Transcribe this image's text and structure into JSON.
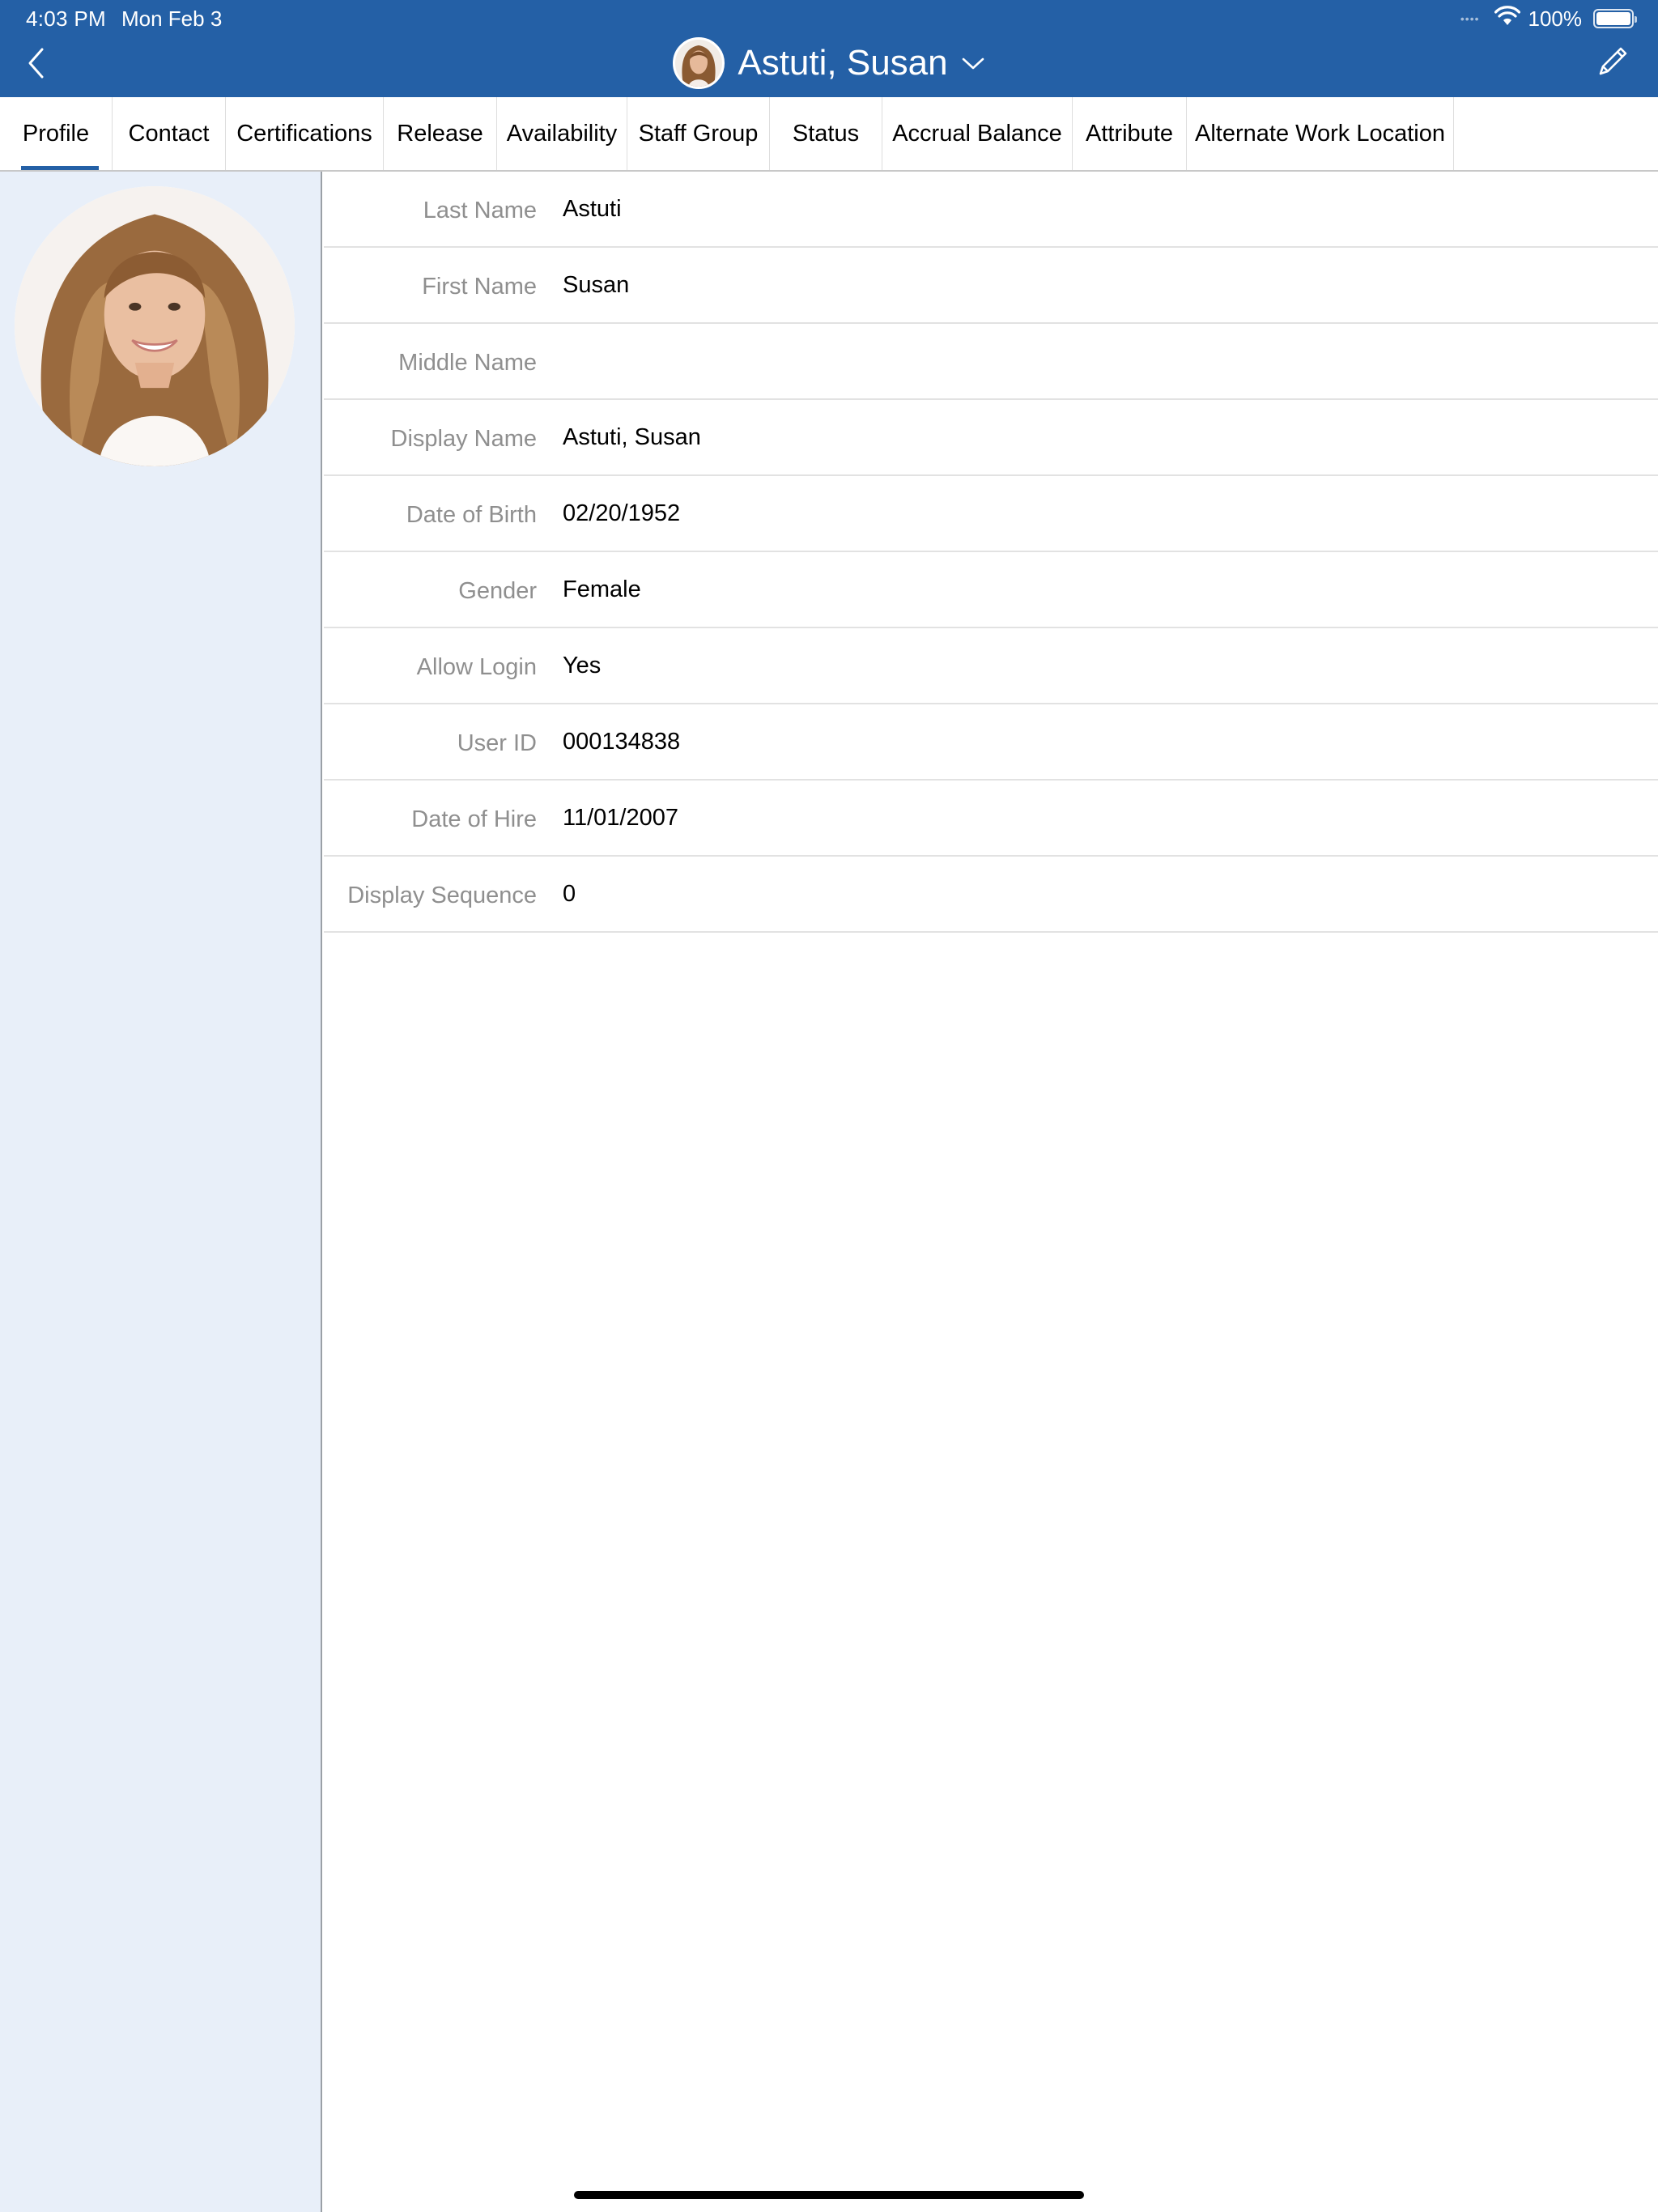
{
  "status_bar": {
    "time": "4:03 PM",
    "date": "Mon Feb 3",
    "signal_dots": "••••",
    "battery_text": "100%",
    "battery_level": 1.0
  },
  "header": {
    "title": "Astuti, Susan",
    "back_icon": "chevron-left-icon",
    "dropdown_icon": "chevron-down-icon",
    "edit_icon": "pencil-icon"
  },
  "tabs": [
    {
      "label": "Profile",
      "active": true
    },
    {
      "label": "Contact"
    },
    {
      "label": "Certifications"
    },
    {
      "label": "Release"
    },
    {
      "label": "Availability"
    },
    {
      "label": "Staff Group"
    },
    {
      "label": "Status"
    },
    {
      "label": "Accrual Balance"
    },
    {
      "label": "Attribute"
    },
    {
      "label": "Alternate Work Location"
    }
  ],
  "profile": {
    "fields": [
      {
        "label": "Last Name",
        "value": "Astuti"
      },
      {
        "label": "First Name",
        "value": "Susan"
      },
      {
        "label": "Middle Name",
        "value": ""
      },
      {
        "label": "Display Name",
        "value": "Astuti, Susan"
      },
      {
        "label": "Date of Birth",
        "value": "02/20/1952"
      },
      {
        "label": "Gender",
        "value": "Female"
      },
      {
        "label": "Allow Login",
        "value": "Yes"
      },
      {
        "label": "User ID",
        "value": "000134838"
      },
      {
        "label": "Date of Hire",
        "value": "11/01/2007"
      },
      {
        "label": "Display Sequence",
        "value": "0"
      }
    ]
  },
  "colors": {
    "header_bg": "#2460a6",
    "sidebar_bg": "#e8eff9",
    "label_text": "#8f8f8f",
    "tab_indicator": "#2460a6"
  }
}
